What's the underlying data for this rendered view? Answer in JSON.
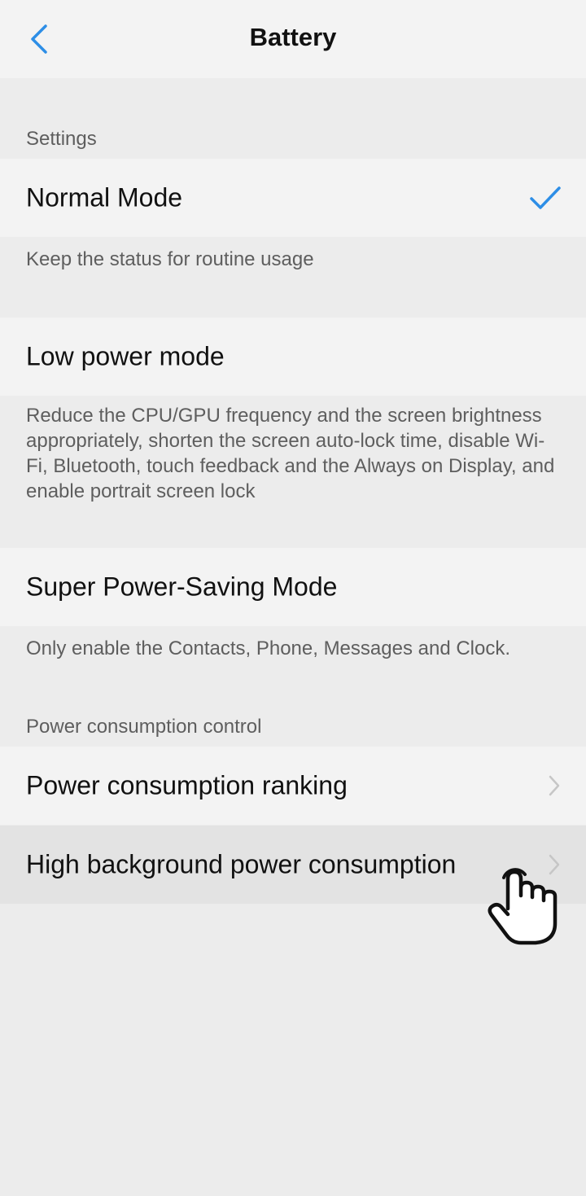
{
  "header": {
    "title": "Battery"
  },
  "sections": {
    "settings_label": "Settings",
    "power_control_label": "Power consumption control"
  },
  "modes": {
    "normal": {
      "label": "Normal Mode",
      "description": "Keep the status for routine usage",
      "selected": true
    },
    "low_power": {
      "label": "Low power mode",
      "description": "Reduce the CPU/GPU frequency and the screen brightness appropriately, shorten the screen auto-lock time, disable Wi-Fi, Bluetooth, touch feedback and the Always on Display, and enable portrait screen lock"
    },
    "super_saving": {
      "label": "Super Power-Saving Mode",
      "description": "Only enable the Contacts, Phone, Messages and Clock."
    }
  },
  "power_control": {
    "ranking_label": "Power consumption ranking",
    "background_label": "High background power consumption"
  },
  "icons": {
    "back": "chevron-left-icon",
    "check": "checkmark-icon",
    "chevron": "chevron-right-icon",
    "hand": "tap-hand-pointer-icon"
  },
  "colors": {
    "accent": "#2d8ee6",
    "background": "#ececec",
    "row_background": "#f3f3f3",
    "secondary_text": "#5e5e5e"
  }
}
